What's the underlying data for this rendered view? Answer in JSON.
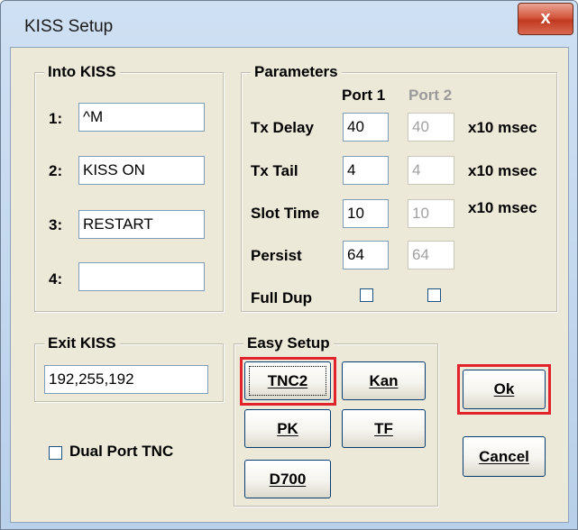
{
  "window": {
    "title": "KISS Setup",
    "close_glyph": "x"
  },
  "into_kiss": {
    "legend": "Into KISS",
    "rows": [
      {
        "label": "1:",
        "value": "^M"
      },
      {
        "label": "2:",
        "value": "KISS ON"
      },
      {
        "label": "3:",
        "value": "RESTART"
      },
      {
        "label": "4:",
        "value": ""
      }
    ]
  },
  "parameters": {
    "legend": "Parameters",
    "port1_header": "Port 1",
    "port2_header": "Port 2",
    "rows": [
      {
        "label": "Tx Delay",
        "port1": "40",
        "port2": "40",
        "unit": "x10 msec"
      },
      {
        "label": "Tx Tail",
        "port1": "4",
        "port2": "4",
        "unit": "x10 msec"
      },
      {
        "label": "Slot Time",
        "port1": "10",
        "port2": "10",
        "unit": "x10 msec"
      },
      {
        "label": "Persist",
        "port1": "64",
        "port2": "64",
        "unit": ""
      }
    ],
    "full_dup_label": "Full Dup",
    "full_dup_port1_checked": false,
    "full_dup_port2_checked": false
  },
  "exit_kiss": {
    "legend": "Exit KISS",
    "value": "192,255,192"
  },
  "dual_port": {
    "label": "Dual Port TNC",
    "checked": false
  },
  "easy_setup": {
    "legend": "Easy Setup",
    "tnc2": "TNC2",
    "kan": "Kan",
    "pk": "PK",
    "tf": "TF",
    "d700": "D700"
  },
  "buttons": {
    "ok": "Ok",
    "cancel": "Cancel"
  },
  "highlight_color": "#e3232b"
}
